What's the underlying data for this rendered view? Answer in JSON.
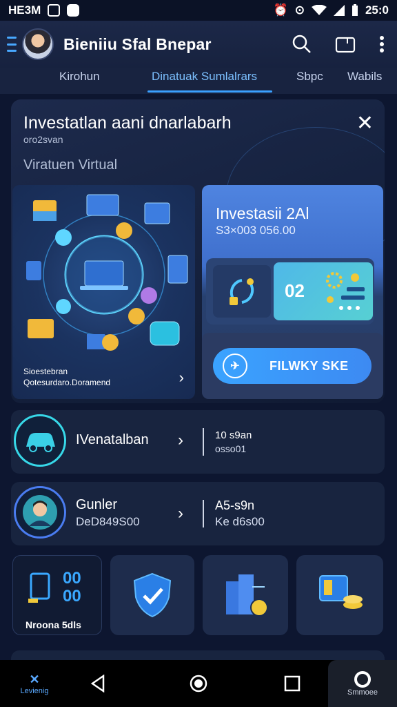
{
  "status_bar": {
    "left_text": "HE3M",
    "time": "25:0"
  },
  "app_bar": {
    "title": "Bieniiu Sfal Bnepar"
  },
  "tabs": [
    {
      "label": "Kirohun"
    },
    {
      "label": "Dinatuak  Sumlalrars"
    },
    {
      "label": "Sbpc"
    },
    {
      "label": "Wabils"
    }
  ],
  "main_card": {
    "title": "Investatlan aani dnarlabarh",
    "subtitle": "oro2svan",
    "label": "Viratuen Virtual",
    "illustration_caption_1": "Sioestebran",
    "illustration_caption_2": "Qotesurdaro.Doramend",
    "investment": {
      "title": "Investasii 2Al",
      "amount": "S3×003 056.00",
      "stat_value": "02",
      "cta_label": "FILWKY SKE"
    }
  },
  "rows": [
    {
      "name": "IVenatalban",
      "right_1": "10 s9an",
      "right_2": "osso01"
    },
    {
      "name": "Gunler",
      "sub": "DeD849S00",
      "right_1": "A5-s9n",
      "right_2": "Ke d6s00"
    }
  ],
  "tiles": {
    "first_label": "Nroona 5dls",
    "first_digits_top": "00",
    "first_digits_bottom": "00"
  },
  "nav": {
    "left_label": "Levienig",
    "right_label": "Smmoee"
  },
  "colors": {
    "accent": "#3aa0ff",
    "teal": "#37d8e8",
    "background": "#0d1630"
  }
}
